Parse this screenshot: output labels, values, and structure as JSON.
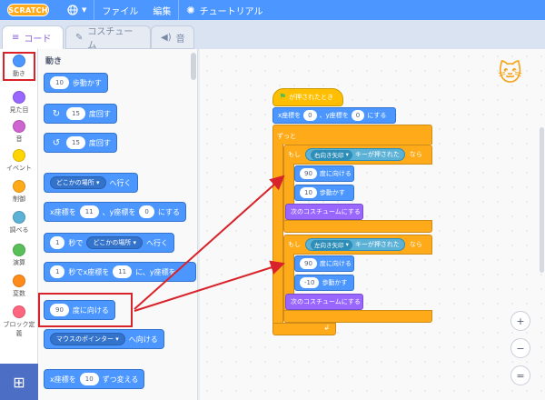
{
  "menubar": {
    "logo": "SCRATCH",
    "file": "ファイル",
    "edit": "編集",
    "tutorial": "チュートリアル",
    "globe_icon": "globe-icon",
    "bulb_icon": "lightbulb-icon"
  },
  "tabs": [
    {
      "label": "コード",
      "icon": "code-icon"
    },
    {
      "label": "コスチューム",
      "icon": "brush-icon"
    },
    {
      "label": "音",
      "icon": "speaker-icon"
    }
  ],
  "categories": [
    {
      "label": "動き",
      "color": "#4c97ff"
    },
    {
      "label": "見た目",
      "color": "#9966ff"
    },
    {
      "label": "音",
      "color": "#cf63cf"
    },
    {
      "label": "イベント",
      "color": "#ffd500"
    },
    {
      "label": "制御",
      "color": "#ffab19"
    },
    {
      "label": "調べる",
      "color": "#5cb1d6"
    },
    {
      "label": "演算",
      "color": "#59c059"
    },
    {
      "label": "変数",
      "color": "#ff8c1a"
    },
    {
      "label": "ブロック定義",
      "color": "#ff6680"
    }
  ],
  "palette": {
    "title": "動き",
    "move": {
      "value": "10",
      "label": "歩動かす"
    },
    "turn_right": {
      "value": "15",
      "label": "度回す"
    },
    "turn_left": {
      "value": "15",
      "label": "度回す"
    },
    "goto": {
      "drop": "どこかの場所",
      "label": "へ行く"
    },
    "goto_xy": {
      "x_label": "x座標を",
      "x": "11",
      "y_label": "、y座標を",
      "y": "0",
      "label": "にする"
    },
    "glide": {
      "value": "1",
      "mid": "秒で",
      "drop": "どこかの場所",
      "label": "へ行く"
    },
    "glide_xy": {
      "value": "1",
      "mid": "秒でx座標を",
      "x": "11",
      "y_label": "に、y座標を"
    },
    "point_dir": {
      "value": "90",
      "label": "度に向ける"
    },
    "point_towards": {
      "drop": "マウスのポインター",
      "label": "へ向ける"
    },
    "change_x": {
      "x_label": "x座標を",
      "value": "10",
      "label": "ずつ変える"
    }
  },
  "script": {
    "hat": "が押されたとき",
    "set_xy": {
      "x_label": "x座標を",
      "x": "0",
      "y_label": "、y座標を",
      "y": "0",
      "label": "にする"
    },
    "forever": "ずっと",
    "if1": {
      "if": "もし",
      "key": "右向き矢印",
      "key_label": "キーが押された",
      "then": "なら",
      "dir": "90",
      "dir_label": "度に向ける",
      "steps": "10",
      "steps_label": "歩動かす",
      "costume": "次のコスチュームにする"
    },
    "if2": {
      "if": "もし",
      "key": "左向き矢印",
      "key_label": "キーが押された",
      "then": "なら",
      "dir": "90",
      "dir_label": "度に向ける",
      "steps": "-10",
      "steps_label": "歩動かす",
      "costume": "次のコスチュームにする"
    }
  },
  "zoom": {
    "in": "+",
    "out": "−",
    "reset": "="
  },
  "colors": {
    "menubar": "#4c97ff",
    "highlight": "#d9232b",
    "motion": "#4c97ff",
    "looks": "#9966ff",
    "control": "#ffab19",
    "sensing": "#5cb1d6"
  }
}
